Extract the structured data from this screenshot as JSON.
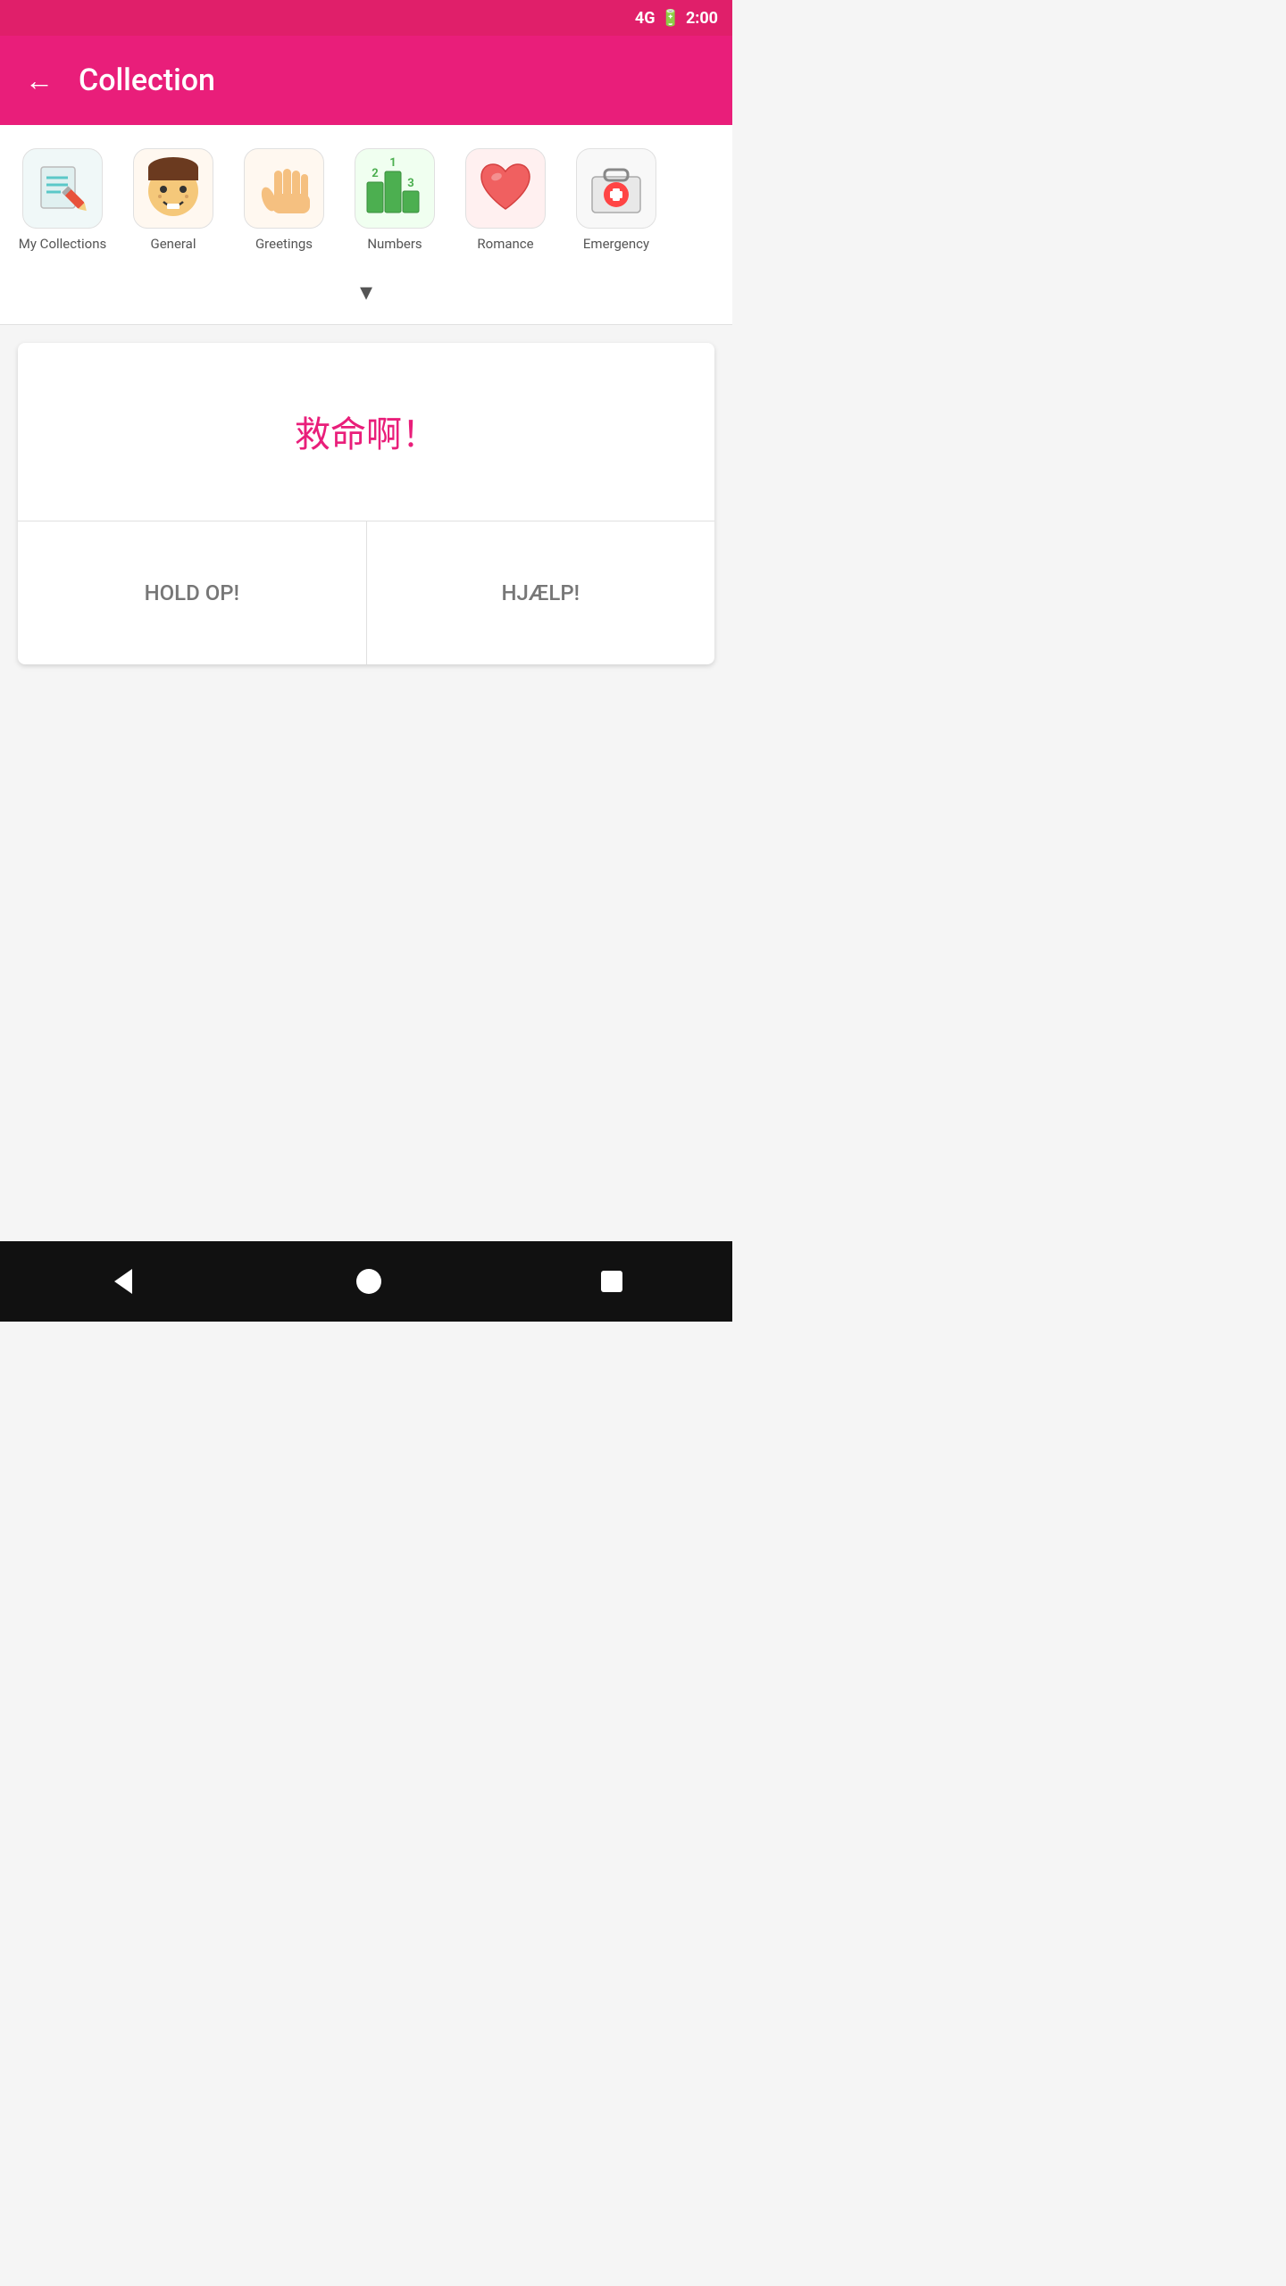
{
  "statusBar": {
    "signal": "4G",
    "time": "2:00"
  },
  "appBar": {
    "title": "Collection",
    "backLabel": "←"
  },
  "categories": [
    {
      "id": "my-collections",
      "label": "My Collections",
      "icon": "notebook-pencil",
      "class": "my-collections"
    },
    {
      "id": "general",
      "label": "General",
      "icon": "face-emoji",
      "class": "general"
    },
    {
      "id": "greetings",
      "label": "Greetings",
      "icon": "hand-wave",
      "class": "greetings"
    },
    {
      "id": "numbers",
      "label": "Numbers",
      "icon": "numbers-podium",
      "class": "numbers"
    },
    {
      "id": "romance",
      "label": "Romance",
      "icon": "heart",
      "class": "romance"
    },
    {
      "id": "emergency",
      "label": "Emergency",
      "icon": "medical-kit",
      "class": "emergency"
    }
  ],
  "chevron": "▾",
  "flashcard": {
    "chinese": "救命啊！",
    "translations": [
      {
        "id": "dutch",
        "text": "HOLD OP!"
      },
      {
        "id": "danish",
        "text": "HJÆLP!"
      }
    ]
  },
  "bottomNav": {
    "back": "◀",
    "home": "●",
    "recent": "■"
  }
}
